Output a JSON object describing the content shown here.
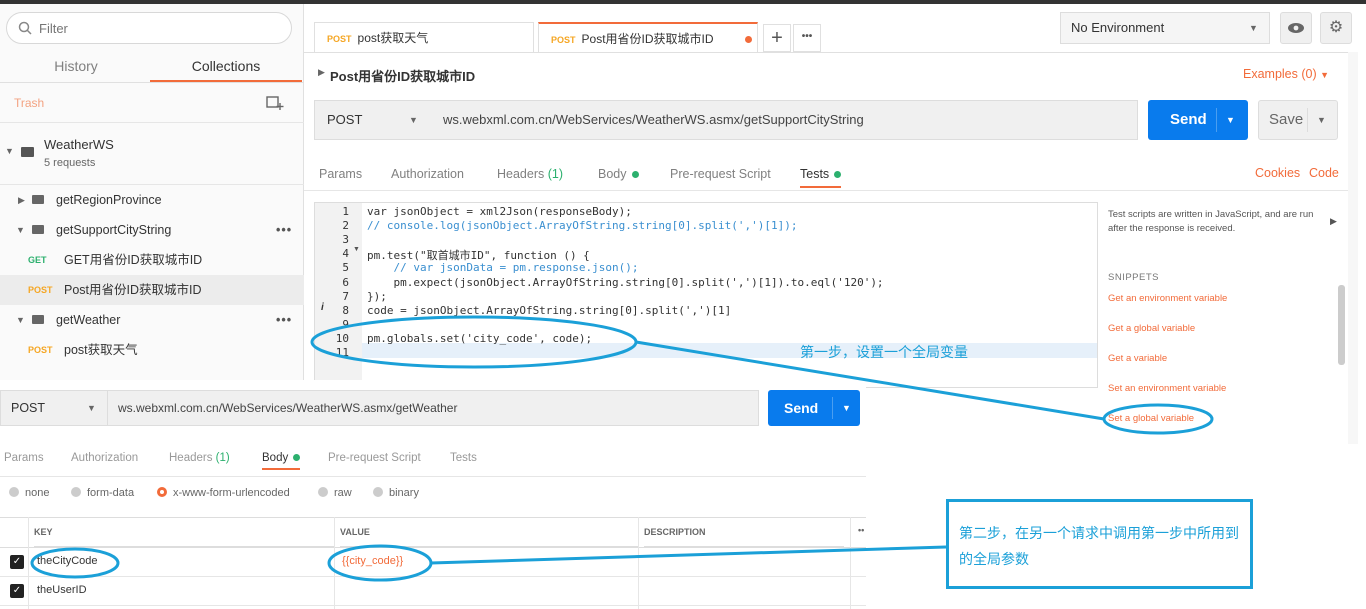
{
  "sidebar": {
    "filter_placeholder": "Filter",
    "tabs": [
      "History",
      "Collections"
    ],
    "trash": "Trash",
    "collection": {
      "name": "WeatherWS",
      "count": "5 requests"
    },
    "items": [
      {
        "label": "getRegionProvince"
      },
      {
        "label": "getSupportCityString"
      },
      {
        "method": "GET",
        "label": "GET用省份ID获取城市ID"
      },
      {
        "method": "POST",
        "label": "Post用省份ID获取城市ID"
      },
      {
        "label": "getWeather"
      },
      {
        "method": "POST",
        "label": "post获取天气"
      }
    ]
  },
  "request_tabs": [
    {
      "method": "POST",
      "label": "post获取天气"
    },
    {
      "method": "POST",
      "label": "Post用省份ID获取城市ID"
    }
  ],
  "environment": "No Environment",
  "request": {
    "title": "Post用省份ID获取城市ID",
    "examples": "Examples (0)",
    "method": "POST",
    "url": "ws.webxml.com.cn/WebServices/WeatherWS.asmx/getSupportCityString",
    "send": "Send",
    "save": "Save",
    "tabs": [
      "Params",
      "Authorization",
      "Headers",
      "(1)",
      "Body",
      "Pre-request Script",
      "Tests"
    ],
    "cookies": "Cookies",
    "code": "Code"
  },
  "editor": {
    "line_numbers": [
      "1",
      "2",
      "3",
      "4",
      "5",
      "6",
      "7",
      "8",
      "9",
      "10",
      "11"
    ],
    "lines": [
      "var jsonObject = xml2Json(responseBody);",
      "// console.log(jsonObject.ArrayOfString.string[0].split(',')[1]);",
      "",
      "pm.test(\"取首城市ID\", function () {",
      "    // var jsonData = pm.response.json();",
      "    pm.expect(jsonObject.ArrayOfString.string[0].split(',')[1]).to.eql('120');",
      "});",
      "code = jsonObject.ArrayOfString.string[0].split(',')[1]",
      "",
      "pm.globals.set('city_code', code);",
      ""
    ]
  },
  "snippets": {
    "description": "Test scripts are written in JavaScript, and are run after the response is received.",
    "heading": "SNIPPETS",
    "items": [
      "Get an environment variable",
      "Get a global variable",
      "Get a variable",
      "Set an environment variable",
      "Set a global variable"
    ]
  },
  "request2": {
    "method": "POST",
    "url": "ws.webxml.com.cn/WebServices/WeatherWS.asmx/getWeather",
    "send": "Send",
    "tabs": [
      "Params",
      "Authorization",
      "Headers",
      "(1)",
      "Body",
      "Pre-request Script",
      "Tests"
    ],
    "body_modes": [
      "none",
      "form-data",
      "x-www-form-urlencoded",
      "raw",
      "binary"
    ],
    "columns": [
      "KEY",
      "VALUE",
      "DESCRIPTION"
    ],
    "rows": [
      {
        "key": "theCityCode",
        "value": "{{city_code}}"
      },
      {
        "key": "theUserID",
        "value": ""
      }
    ]
  },
  "annotations": {
    "step1": "第一步，设置一个全局变量",
    "step2": "第二步，在另一个请求中调用第一步中所用到的全局参数"
  },
  "colors": {
    "accent": "#f26b3a",
    "send": "#097bed",
    "annotation": "#1ba0d8",
    "method_get": "#2cb06e",
    "method_post": "#f5a623"
  }
}
